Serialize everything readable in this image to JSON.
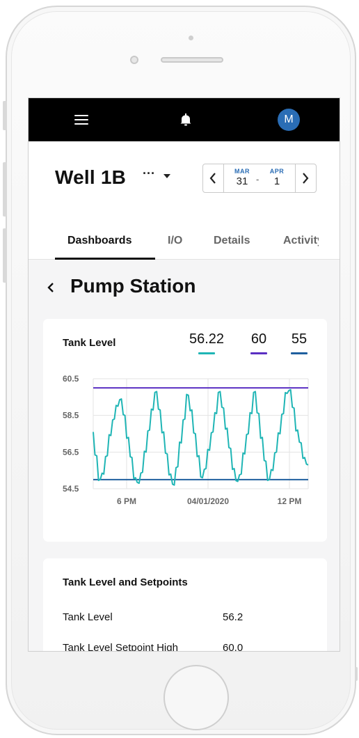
{
  "topbar": {
    "menu_icon": "hamburger-icon",
    "bell_icon": "bell-icon",
    "avatar_initial": "M"
  },
  "header": {
    "asset_name": "Well 1B",
    "more_icon": "···",
    "date_range": {
      "start_month": "MAR",
      "start_day": "31",
      "separator": "-",
      "end_month": "APR",
      "end_day": "1"
    }
  },
  "tabs": [
    {
      "label": "Dashboards",
      "active": true
    },
    {
      "label": "I/O",
      "active": false
    },
    {
      "label": "Details",
      "active": false
    },
    {
      "label": "Activity",
      "active": false
    }
  ],
  "page": {
    "title": "Pump Station"
  },
  "chart_card": {
    "title": "Tank Level",
    "legend": [
      {
        "value": "56.22",
        "color": "#1fb5b5"
      },
      {
        "value": "60",
        "color": "#5a2fc2"
      },
      {
        "value": "55",
        "color": "#1f5f9e"
      }
    ]
  },
  "chart_data": {
    "type": "line",
    "title": "Tank Level",
    "xlabel": "",
    "ylabel": "",
    "ylim": [
      54.5,
      60.5
    ],
    "y_ticks": [
      "60.5",
      "58.5",
      "56.5",
      "54.5"
    ],
    "x_ticks": [
      "6 PM",
      "04/01/2020",
      "12 PM"
    ],
    "grid": true,
    "series": [
      {
        "values": [
          57.6,
          56.3,
          55.0,
          55.3,
          56.3,
          57.4,
          58.3,
          59.0,
          59.4,
          58.5,
          57.3,
          56.2,
          55.1,
          54.8,
          55.4,
          56.5,
          57.7,
          58.8,
          59.8,
          58.8,
          57.6,
          56.4,
          55.3,
          54.7,
          55.7,
          57.0,
          58.3,
          59.6,
          58.8,
          57.5,
          56.3,
          55.1,
          55.6,
          56.6,
          57.6,
          58.6,
          59.8,
          58.9,
          57.8,
          56.7,
          55.6,
          54.9,
          55.3,
          56.4,
          57.5,
          58.6,
          59.8,
          58.6,
          57.3,
          56.0,
          55.0,
          55.5,
          56.5,
          57.5,
          58.6,
          59.7,
          59.9,
          58.9,
          57.7,
          57.0,
          56.2,
          55.8
        ],
        "color": "#1fb5b5"
      },
      {
        "values": [
          60,
          60
        ],
        "color": "#5a2fc2"
      },
      {
        "values": [
          55,
          55
        ],
        "color": "#1f5f9e"
      }
    ]
  },
  "list_card": {
    "title": "Tank Level and Setpoints",
    "rows": [
      {
        "label": "Tank Level",
        "value": "56.2"
      },
      {
        "label": "Tank Level Setpoint High",
        "value": "60.0"
      }
    ]
  },
  "device": {
    "home_button": "home-button"
  }
}
